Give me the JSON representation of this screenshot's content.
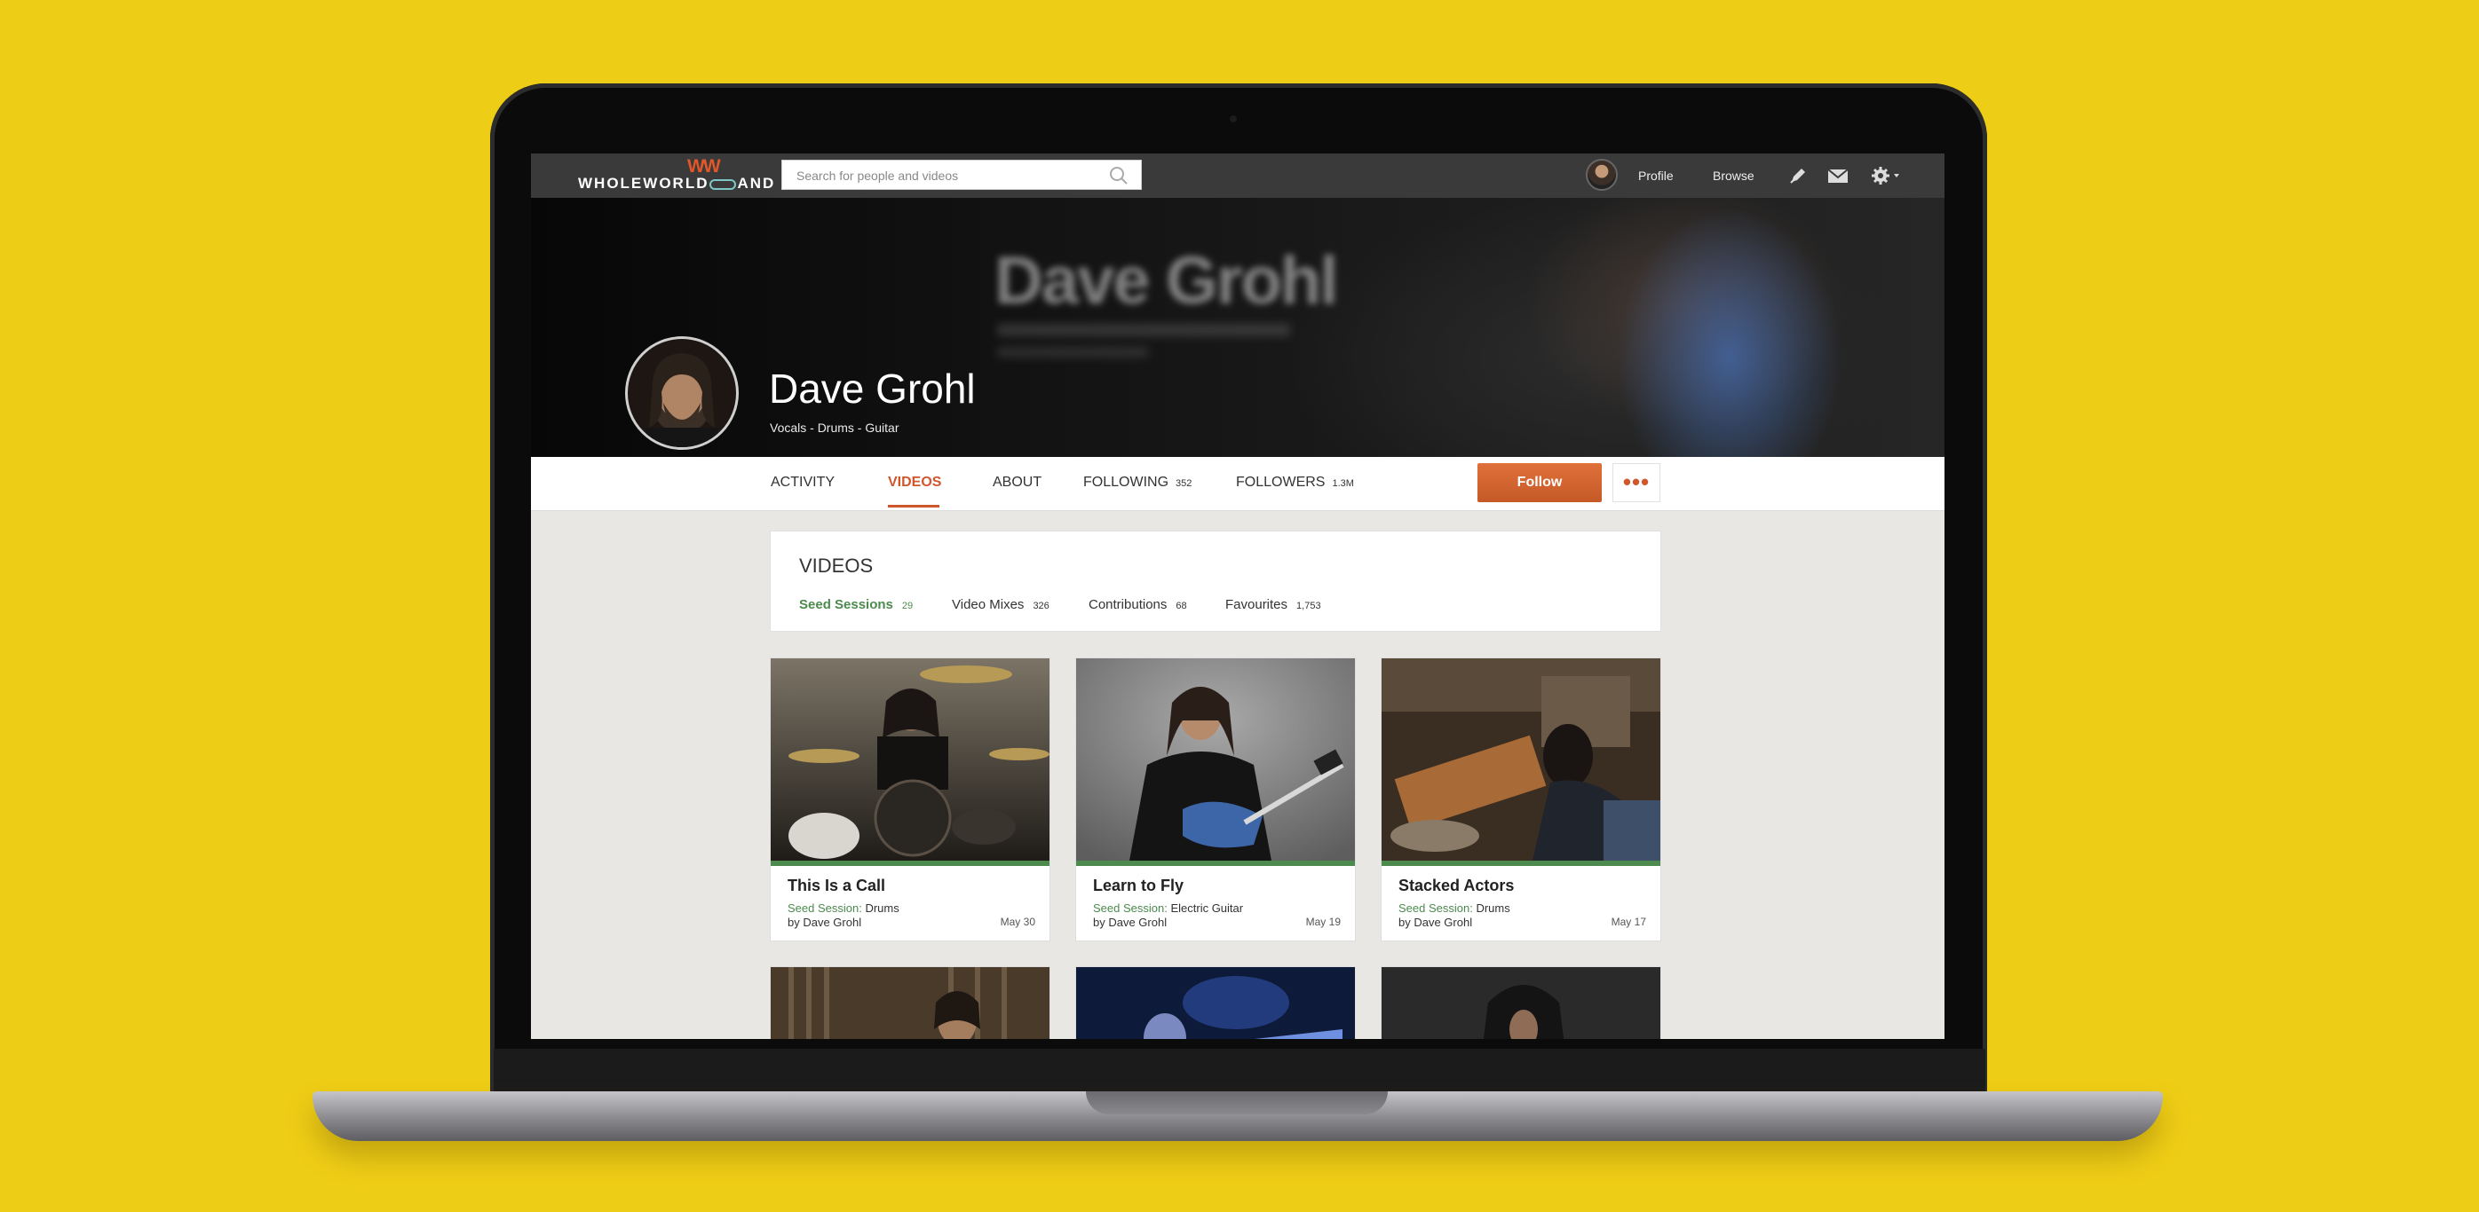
{
  "nav": {
    "logo_left": "WHOLEWORLD",
    "logo_right": "AND",
    "logo_mark": "WW",
    "search_placeholder": "Search for people and videos",
    "profile": "Profile",
    "browse": "Browse",
    "icons": [
      "search-icon",
      "avatar",
      "pen-icon",
      "mail-icon",
      "gear-icon"
    ]
  },
  "profile": {
    "name": "Dave Grohl",
    "subtitle": "Vocals - Drums - Guitar",
    "banner_text": "Dave Grohl"
  },
  "tabs": [
    {
      "label": "ACTIVITY",
      "count": ""
    },
    {
      "label": "VIDEOS",
      "count": "",
      "active": true
    },
    {
      "label": "ABOUT",
      "count": ""
    },
    {
      "label": "FOLLOWING",
      "count": "352"
    },
    {
      "label": "FOLLOWERS",
      "count": "1.3M"
    }
  ],
  "actions": {
    "follow": "Follow",
    "more": "•••"
  },
  "videos": {
    "title": "VIDEOS",
    "subtabs": [
      {
        "label": "Seed Sessions",
        "count": "29",
        "active": true
      },
      {
        "label": "Video Mixes",
        "count": "326"
      },
      {
        "label": "Contributions",
        "count": "68"
      },
      {
        "label": "Favourites",
        "count": "1,753"
      }
    ],
    "cards": [
      {
        "title": "This Is a Call",
        "session_label": "Seed Session:",
        "instrument": "Drums",
        "by": "by Dave Grohl",
        "date": "May 30"
      },
      {
        "title": "Learn to Fly",
        "session_label": "Seed Session:",
        "instrument": "Electric Guitar",
        "by": "by Dave Grohl",
        "date": "May 19"
      },
      {
        "title": "Stacked Actors",
        "session_label": "Seed Session:",
        "instrument": "Drums",
        "by": "by Dave Grohl",
        "date": "May 17"
      }
    ]
  },
  "colors": {
    "background": "#eecd16",
    "accent": "#d0562b",
    "green": "#4c8a4e",
    "nav": "#3a3a3a"
  }
}
